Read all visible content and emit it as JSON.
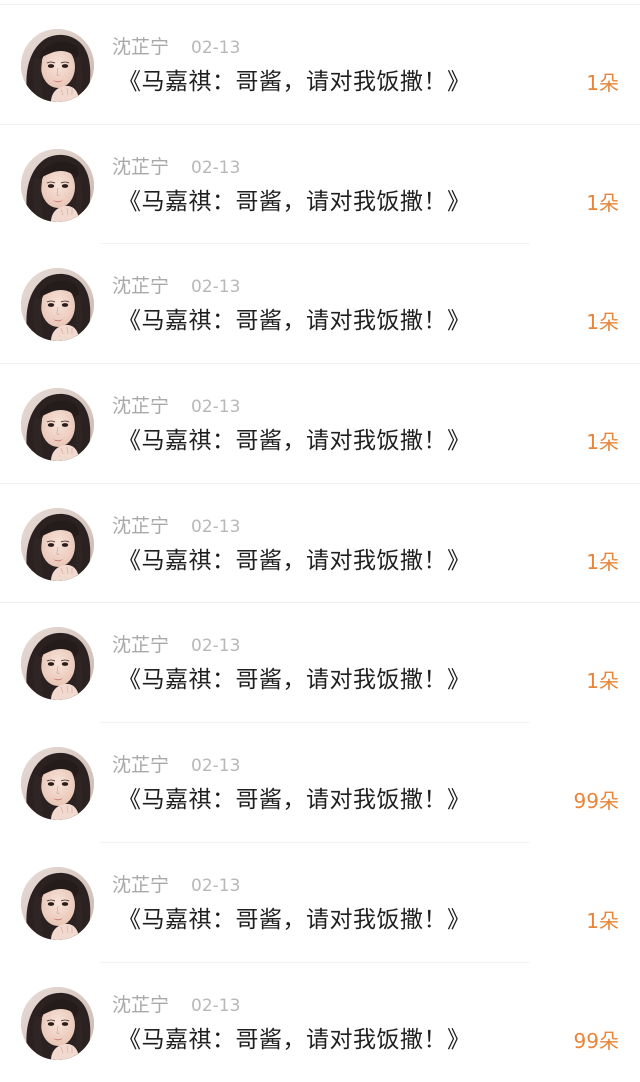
{
  "colors": {
    "name": "#a9a9a9",
    "date": "#b8b8b8",
    "message": "#1f1f1f",
    "gift": "#e8853a",
    "divider": "#efefef"
  },
  "items": [
    {
      "name": "沈芷宁",
      "date": "02-13",
      "message": "《马嘉祺：哥酱，请对我饭撒！》",
      "gift": "1朵",
      "avatar_icon": "woman-portrait-avatar"
    },
    {
      "name": "沈芷宁",
      "date": "02-13",
      "message": "《马嘉祺：哥酱，请对我饭撒！》",
      "gift": "1朵",
      "avatar_icon": "woman-portrait-avatar"
    },
    {
      "name": "沈芷宁",
      "date": "02-13",
      "message": "《马嘉祺：哥酱，请对我饭撒！》",
      "gift": "1朵",
      "avatar_icon": "woman-portrait-avatar"
    },
    {
      "name": "沈芷宁",
      "date": "02-13",
      "message": "《马嘉祺：哥酱，请对我饭撒！》",
      "gift": "1朵",
      "avatar_icon": "woman-portrait-avatar"
    },
    {
      "name": "沈芷宁",
      "date": "02-13",
      "message": "《马嘉祺：哥酱，请对我饭撒！》",
      "gift": "1朵",
      "avatar_icon": "woman-portrait-avatar"
    },
    {
      "name": "沈芷宁",
      "date": "02-13",
      "message": "《马嘉祺：哥酱，请对我饭撒！》",
      "gift": "1朵",
      "avatar_icon": "woman-portrait-avatar"
    },
    {
      "name": "沈芷宁",
      "date": "02-13",
      "message": "《马嘉祺：哥酱，请对我饭撒！》",
      "gift": "99朵",
      "avatar_icon": "woman-portrait-avatar"
    },
    {
      "name": "沈芷宁",
      "date": "02-13",
      "message": "《马嘉祺：哥酱，请对我饭撒！》",
      "gift": "1朵",
      "avatar_icon": "woman-portrait-avatar"
    },
    {
      "name": "沈芷宁",
      "date": "02-13",
      "message": "《马嘉祺：哥酱，请对我饭撒！》",
      "gift": "99朵",
      "avatar_icon": "woman-portrait-avatar"
    }
  ]
}
